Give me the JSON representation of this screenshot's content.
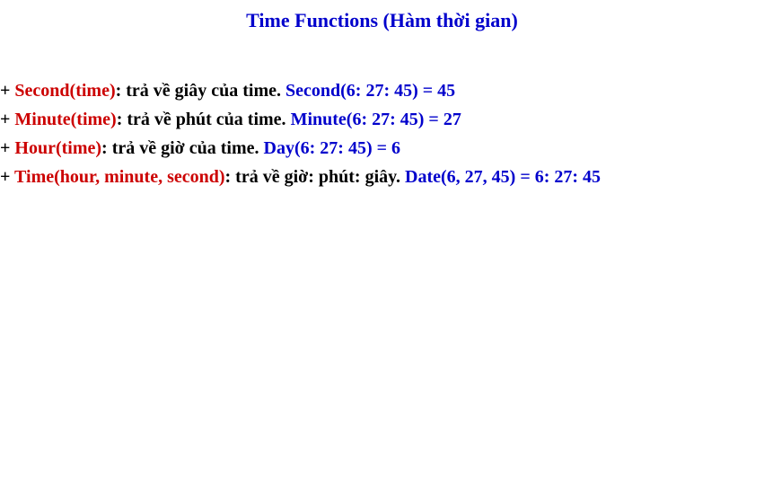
{
  "title": "Time Functions (Hàm thời gian)",
  "lines": [
    {
      "plus": "+ ",
      "func": "Second(time)",
      "desc": ": trả về giây của time. ",
      "example": "Second(6: 27: 45) = 45"
    },
    {
      "plus": "+ ",
      "func": "Minute(time)",
      "desc": ": trả về phút của time. ",
      "example": "Minute(6: 27: 45) = 27"
    },
    {
      "plus": "+ ",
      "func": "Hour(time)",
      "desc": ": trả về giờ của time. ",
      "example": "Day(6: 27: 45) = 6"
    },
    {
      "plus": "+ ",
      "func": "Time(hour, minute, second)",
      "desc": ": trả về giờ: phút: giây. ",
      "example": "Date(6, 27, 45) = 6: 27: 45"
    }
  ]
}
